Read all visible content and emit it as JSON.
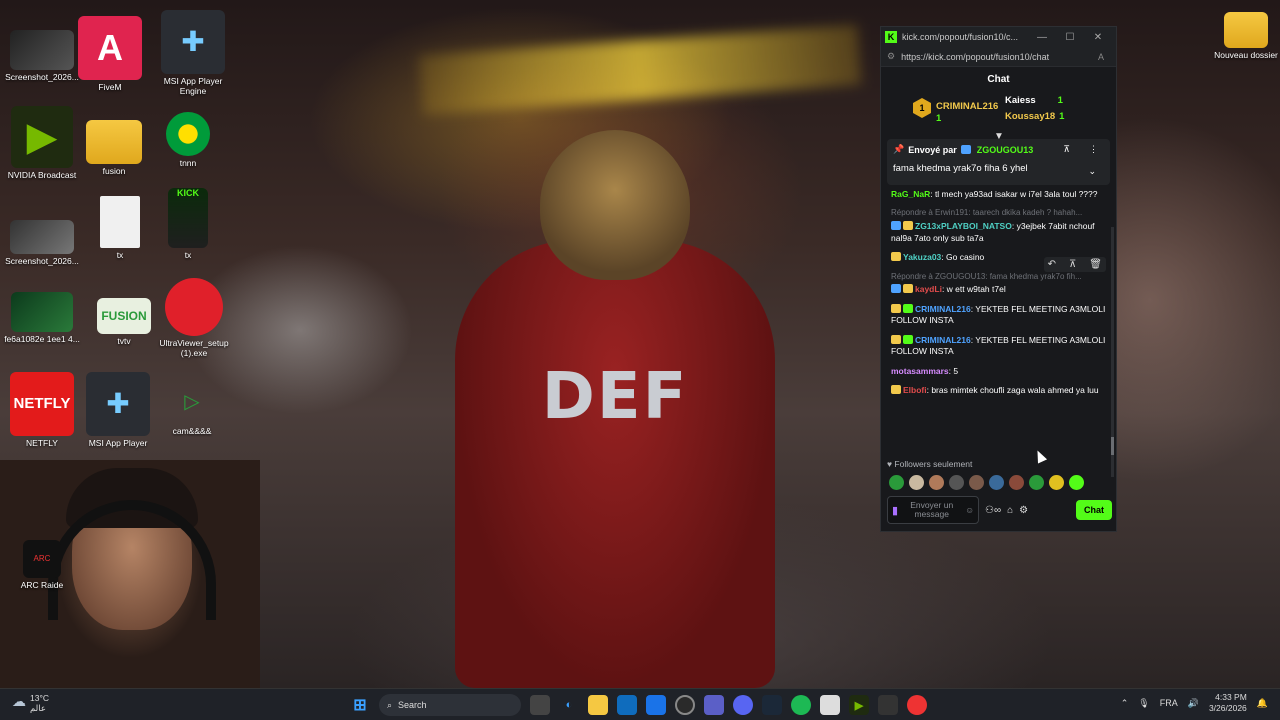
{
  "desktop": {
    "icons": [
      {
        "label": "Screenshot_2026..."
      },
      {
        "label": "FiveM"
      },
      {
        "label": "MSI App Player Engine"
      },
      {
        "label": "NVIDIA Broadcast"
      },
      {
        "label": "fusion"
      },
      {
        "label": "tnnn"
      },
      {
        "label": "Screenshot_2026..."
      },
      {
        "label": "tx"
      },
      {
        "label": "tx"
      },
      {
        "label": "fe6a1082e 1ee1 4..."
      },
      {
        "label": "tvtv"
      },
      {
        "label": "UltraViewer_setup (1).exe"
      },
      {
        "label": "NETFLY"
      },
      {
        "label": "MSI App Player"
      },
      {
        "label": "cam&&&&"
      },
      {
        "label": "ARC Raide"
      },
      {
        "label": "Nouveau dossier"
      }
    ],
    "game_text": "DEF"
  },
  "popup": {
    "window_title": "kick.com/popout/fusion10/c...",
    "url": "https://kick.com/popout/fusion10/chat",
    "header": "Chat",
    "leaderboard": {
      "first": {
        "rank": "1",
        "name": "CRIMINAL216",
        "count": "1"
      },
      "second": {
        "name": "Kaiess",
        "count": "1"
      },
      "third": {
        "name": "Koussay18",
        "count": "1"
      }
    },
    "pinned": {
      "sent_by": "Envoyé par",
      "user": "ZGOUGOU13",
      "message": "fama khedma yrak7o fiha 6 yhel"
    },
    "messages": [
      {
        "user": "RaG_NaR",
        "color": "#53fc18",
        "text": ": tl mech ya93ad isakar w i7el 3ala toul ????"
      },
      {
        "reply": "Répondre à Erwin191: taarech dkika kadeh ? hahah...",
        "user": "ZG13xPLAYBOI_NATSO",
        "color": "#4fd1c5",
        "text": ": y3ejbek 7abit nchouf nal9a 7ato only sub ta7a"
      },
      {
        "user": "Yakuza03",
        "color": "#4fd1c5",
        "text": ": Go casino"
      },
      {
        "reply": "Répondre à ZGOUGOU13: fama khedma yrak7o fih...",
        "user": "kaydLi",
        "color": "#e24c4c",
        "text": ": w ett w9tah t7el"
      },
      {
        "user": "CRIMINAL216",
        "color": "#4fa3ff",
        "text": ": YEKTEB FEL MEETING A3MLOLI FOLLOW INSTA"
      },
      {
        "user": "CRIMINAL216",
        "color": "#4fa3ff",
        "text": ": YEKTEB FEL MEETING A3MLOLI FOLLOW INSTA"
      },
      {
        "user": "motasammars",
        "color": "#d78cff",
        "text": ": 5"
      },
      {
        "user": "Elbofi",
        "color": "#e24c4c",
        "text": ": bras mimtek choufli zaga wala ahmed ya luu"
      }
    ],
    "followers_only": "Followers seulement",
    "input_placeholder": "Envoyer un message",
    "chat_button": "Chat"
  },
  "taskbar": {
    "temperature": "13°C",
    "weather_label": "عالم",
    "search_label": "Search",
    "language": "FRA",
    "time": "4:33 PM",
    "date": "3/26/2026"
  },
  "colors": {
    "kick_green": "#53fc18",
    "popup_bg": "#18191c",
    "taskbar_bg": "#1f2228"
  }
}
